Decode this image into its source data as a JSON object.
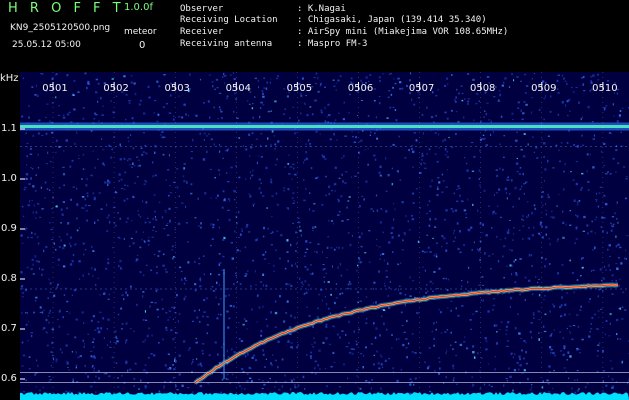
{
  "header": {
    "title": "H R O F F T",
    "version": "1.0.0f",
    "filename": "KN9_2505120500.png",
    "timestamp": "25.05.12 05:00",
    "meteor_label": "meteor",
    "meteor_count": "0",
    "info": [
      {
        "label": "Observer",
        "value": ": K.Nagai"
      },
      {
        "label": "Receiving Location",
        "value": ": Chigasaki, Japan (139.414 35.340)"
      },
      {
        "label": "Receiver",
        "value": ": AirSpy mini (Miakejima VOR 108.65MHz)"
      },
      {
        "label": "Receiving antenna",
        "value": ": Maspro FM-3"
      }
    ]
  },
  "spectrogram": {
    "y_unit": "kHz",
    "y_ticks": [
      "1.1",
      "1.0",
      "0.9",
      "0.8",
      "0.7",
      "0.6"
    ],
    "x_ticks": [
      "0501",
      "0502",
      "0503",
      "0504",
      "0505",
      "0506",
      "0507",
      "0508",
      "0509",
      "0510"
    ],
    "colors": {
      "background": "#000040",
      "noise": "#1a3fd0",
      "carrier": "#50f0c0",
      "trace": "#ff3030",
      "floor": "#00e0ff"
    }
  }
}
